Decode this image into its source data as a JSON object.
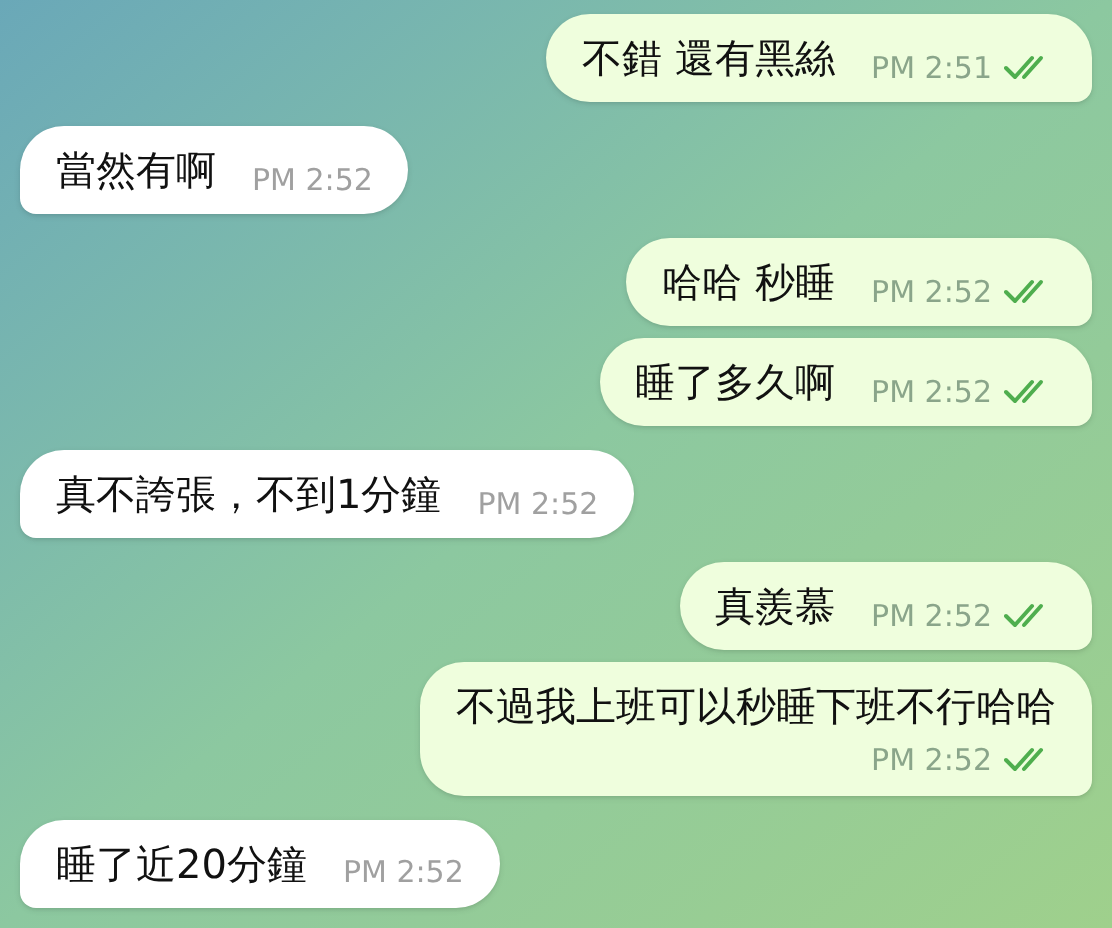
{
  "messages": [
    {
      "kind": "outgoing",
      "text": "不錯 還有黑絲",
      "time": "PM 2:51",
      "read": true
    },
    {
      "kind": "incoming",
      "text": "當然有啊",
      "time": "PM 2:52"
    },
    {
      "kind": "outgoing",
      "text": "哈哈 秒睡",
      "time": "PM 2:52",
      "read": true
    },
    {
      "kind": "outgoing",
      "text": "睡了多久啊",
      "time": "PM 2:52",
      "read": true
    },
    {
      "kind": "incoming",
      "text": "真不誇張，不到1分鐘",
      "time": "PM 2:52"
    },
    {
      "kind": "outgoing",
      "text": "真羨慕",
      "time": "PM 2:52",
      "read": true
    },
    {
      "kind": "outgoing",
      "text": "不過我上班可以秒睡下班不行哈哈",
      "time": "PM 2:52",
      "read": true,
      "wrap_time": true
    },
    {
      "kind": "incoming",
      "text": "睡了近20分鐘",
      "time": "PM 2:52"
    }
  ]
}
